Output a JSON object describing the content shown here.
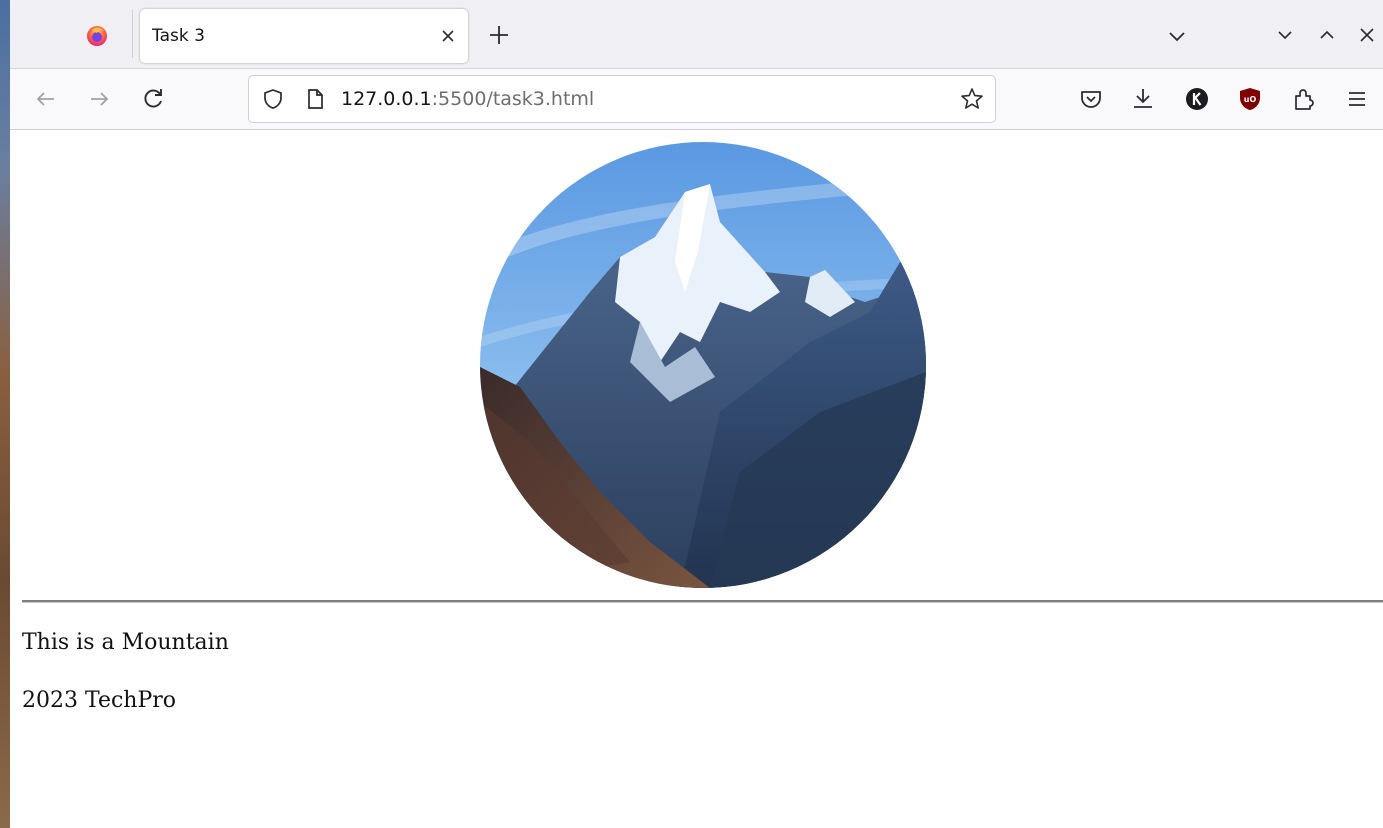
{
  "browser": {
    "tab": {
      "title": "Task 3"
    },
    "url": {
      "host": "127.0.0.1",
      "rest": ":5500/task3.html"
    }
  },
  "page": {
    "image_alt": "Mountain",
    "caption": "This is a Mountain",
    "footer": "2023 TechPro"
  },
  "colors": {
    "toolbar": "#f9f9fb",
    "tabstrip": "#f0f0f4",
    "ublock": "#800000"
  },
  "icons": [
    "firefox-logo-icon",
    "close-icon",
    "plus-icon",
    "chevron-down-icon",
    "back-arrow-icon",
    "forward-arrow-icon",
    "reload-icon",
    "shield-icon",
    "page-icon",
    "star-icon",
    "pocket-icon",
    "download-icon",
    "account-k-icon",
    "ublock-origin-icon",
    "extensions-icon",
    "menu-icon",
    "minimize-icon",
    "maximize-icon",
    "window-close-icon"
  ]
}
